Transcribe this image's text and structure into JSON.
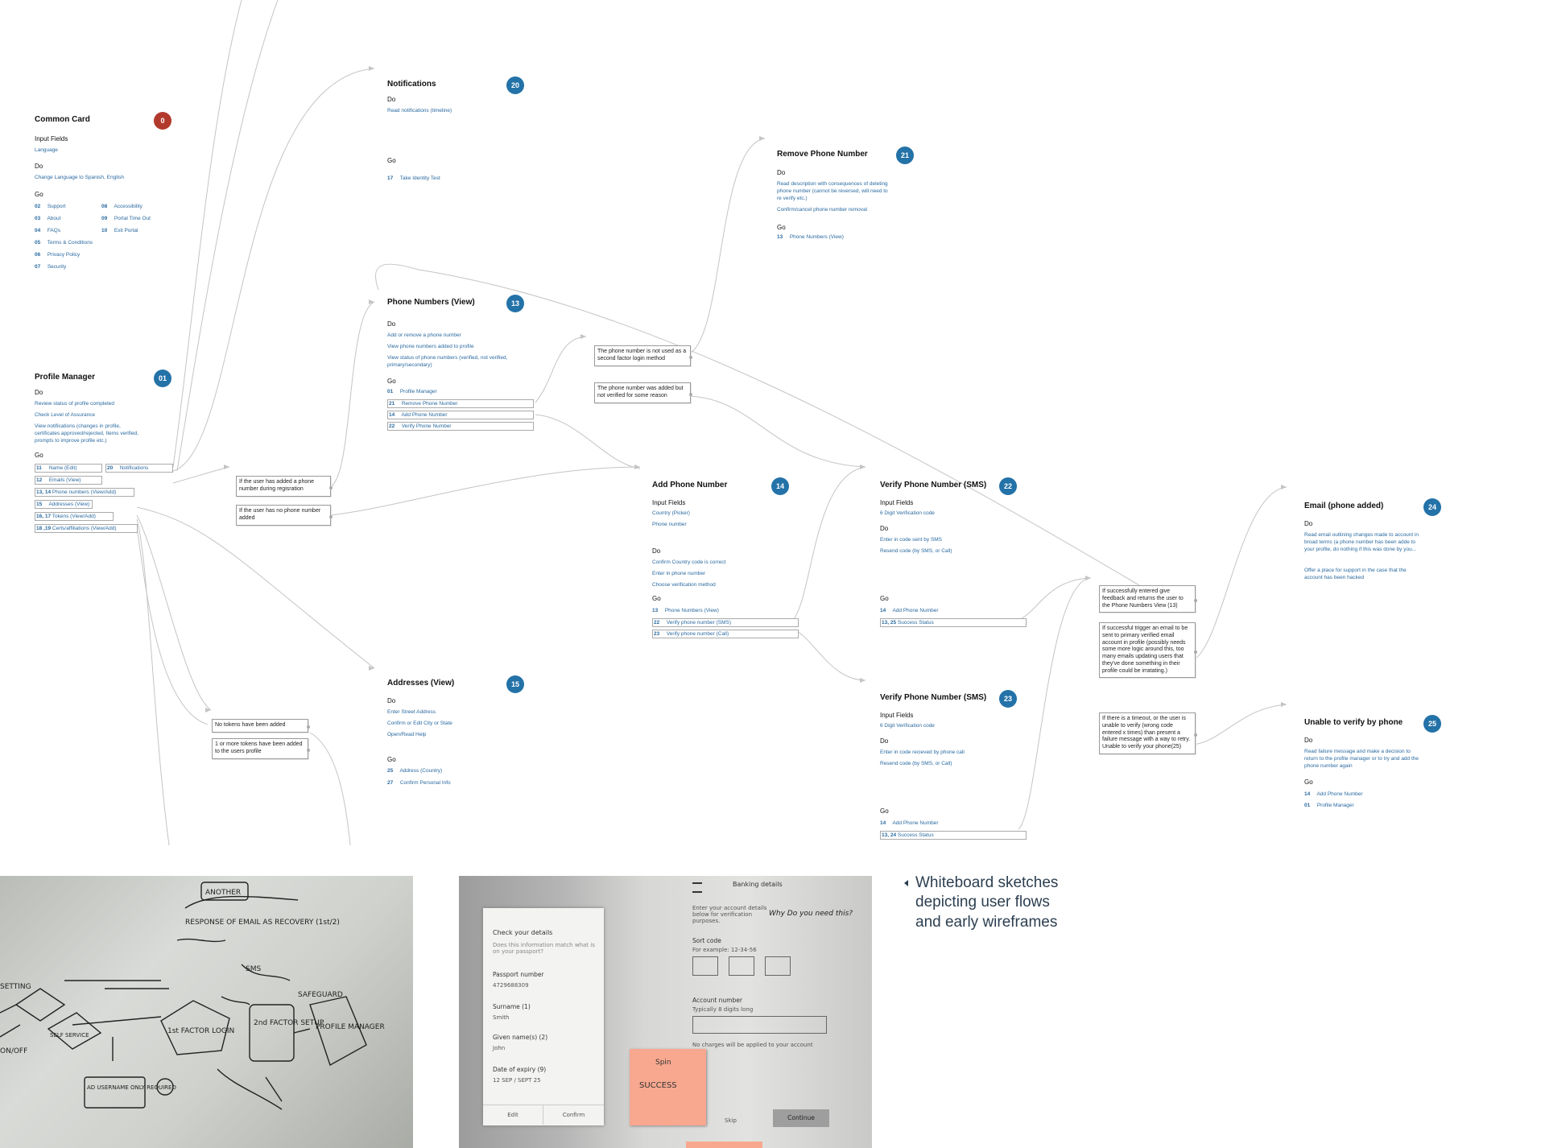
{
  "cards": {
    "common": {
      "title": "Common Card",
      "badge": "0",
      "l1": "Input Fields",
      "f1": "Language",
      "l2": "Do",
      "d1": "Change Language to Spanish, English",
      "l3": "Go",
      "g": [
        {
          "n": "02",
          "t": "Support"
        },
        {
          "n": "03",
          "t": "About"
        },
        {
          "n": "04",
          "t": "FAQs"
        },
        {
          "n": "05",
          "t": "Terms & Conditions"
        },
        {
          "n": "06",
          "t": "Privacy Policy"
        },
        {
          "n": "07",
          "t": "Security"
        },
        {
          "n": "08",
          "t": "Accessibility"
        },
        {
          "n": "09",
          "t": "Portal Time Out"
        },
        {
          "n": "10",
          "t": "Exit Portal"
        }
      ]
    },
    "notifications": {
      "title": "Notifications",
      "badge": "20",
      "l2": "Do",
      "d1": "Read notifications (timeline)",
      "l3": "Go",
      "g": [
        {
          "n": "17",
          "t": "Take Identity Test"
        }
      ]
    },
    "profile": {
      "title": "Profile Manager",
      "badge": "01",
      "l2": "Do",
      "d1": "Review status of profile completed",
      "d2": "Check Level of Assurance",
      "d3": "View notifications (changes in profile, certificates approved/rejected, Items verified, prompts to improve profile etc.)",
      "l3": "Go",
      "g": [
        {
          "n": "11",
          "t": "Name (Edit)"
        },
        {
          "n": "12",
          "t": "Emails (View)"
        },
        {
          "n": "13, 14",
          "t": "Phone numbers (View/Add)"
        },
        {
          "n": "15",
          "t": "Addresses (View)"
        },
        {
          "n": "16, 17",
          "t": "Tokens (View/Add)"
        },
        {
          "n": "18 ,19",
          "t": "Certs/affiliations (View/Add)"
        },
        {
          "n": "20",
          "t": "Notifications"
        }
      ]
    },
    "phone_view": {
      "title": "Phone Numbers (View)",
      "badge": "13",
      "l2": "Do",
      "d1": "Add or remove a phone number",
      "d2": "View phone numbers added to profile",
      "d3": "View status of phone numbers (verified, not verified, primary/secondary)",
      "l3": "Go",
      "g": [
        {
          "n": "01",
          "t": "Profile Manager"
        },
        {
          "n": "21",
          "t": "Remove Phone Number"
        },
        {
          "n": "14",
          "t": "Add Phone Number"
        },
        {
          "n": "22",
          "t": "Verify Phone Number"
        }
      ]
    },
    "remove_phone": {
      "title": "Remove Phone Number",
      "badge": "21",
      "l2": "Do",
      "d1": "Read description with consequences of deleting phone number (cannot be reversed, will need to re verify etc.)",
      "d2": "Confirm/cancel phone number removal",
      "l3": "Go",
      "g": [
        {
          "n": "13",
          "t": "Phone Numbers (View)"
        }
      ]
    },
    "add_phone": {
      "title": "Add Phone Number",
      "badge": "14",
      "l1": "Input Fields",
      "f1": "Country (Picker)",
      "f2": "Phone number",
      "l2": "Do",
      "d1": "Confirm Country code is correct",
      "d2": "Enter in phone number",
      "d3": "Choose verification method",
      "l3": "Go",
      "g": [
        {
          "n": "13",
          "t": "Phone Numbers (View)"
        },
        {
          "n": "22",
          "t": "Verify phone number (SMS)"
        },
        {
          "n": "23",
          "t": "Verify phone number (Call)"
        }
      ]
    },
    "verify_sms": {
      "title": "Verify Phone Number (SMS)",
      "badge": "22",
      "l1": "Input Fields",
      "f1": "6 Digit Verification code",
      "l2": "Do",
      "d1": "Enter in code sent by SMS",
      "d2": "Resend code (by SMS, or Call)",
      "l3": "Go",
      "g": [
        {
          "n": "14",
          "t": "Add Phone Number"
        },
        {
          "n": "13, 25",
          "t": "Success Status"
        }
      ]
    },
    "verify_call": {
      "title": "Verify Phone Number (SMS)",
      "badge": "23",
      "l1": "Input Fields",
      "f1": "6 Digit Verification code",
      "l2": "Do",
      "d1": "Enter in code recieved by phone call",
      "d2": "Resend code (by SMS, or Call)",
      "l3": "Go",
      "g": [
        {
          "n": "14",
          "t": "Add Phone Number"
        },
        {
          "n": "13, 24",
          "t": "Success Status"
        }
      ]
    },
    "addresses": {
      "title": "Addresses (View)",
      "badge": "15",
      "l2": "Do",
      "d1": "Enter Street Address",
      "d2": "Confirm or Edit City or State",
      "d3": "Open/Read Help",
      "l3": "Go",
      "g": [
        {
          "n": "25",
          "t": "Address (Country)"
        },
        {
          "n": "27",
          "t": "Confirm Personal Info"
        }
      ]
    },
    "email_added": {
      "title": "Email (phone added)",
      "badge": "24",
      "l2": "Do",
      "d1": "Read email outlining changes made to account in broad terms (a phone number has been adde to your profile, do nothing if this was done by you...",
      "d2": "Offer a place for support in the case that the account has been hacked"
    },
    "unable": {
      "title": "Unable to verify by phone",
      "badge": "25",
      "l2": "Do",
      "d1": "Read failure message and make a decision to return to the profile manager or to try and add the phone number again",
      "l3": "Go",
      "g": [
        {
          "n": "14",
          "t": "Add Phone Number"
        },
        {
          "n": "01",
          "t": "Profile Manager"
        }
      ]
    }
  },
  "notes": {
    "added_during_reg": "If the user has added a phone number during regisration",
    "no_phone": "If the user has no phone number added",
    "not_used": "The phone number is not used as a second factor login method",
    "not_verified": "The phone number was added but not verified for some reason",
    "no_tokens": "No tokens have been added",
    "tokens_added": "1 or more tokens have been added to the users profile",
    "success_feedback": "If successfully entered give feedback and returns the user to the Phone Numbers View (13)",
    "success_email": "If successful trigger an email to be sent to primary verified email account in profile (possibly needs some more logic around this, too many emails updating users that they've done something in their profile could be irratating.)",
    "timeout": "If there is a timeout, or the user is unable to verify (wrong code entered x times) than present a failure message with a way to retry. Unable to verify your phone(25)"
  },
  "caption": "Whiteboard sketches depicting user flows and early wireframes",
  "sketch2": {
    "title": "Banking details",
    "check": "Check your details",
    "q": "Does this information match what is on your passport?",
    "passport_label": "Passport number",
    "passport": "4729688309",
    "surname_label": "Surname (1)",
    "surname": "Smith",
    "given_label": "Given name(s) (2)",
    "given": "John",
    "expiry_label": "Date of expiry (9)",
    "expiry": "12 SEP / SEPT 25",
    "edit": "Edit",
    "confirm": "Confirm",
    "intro": "Enter your account details below for verification purposes.",
    "why": "Why Do you need this?",
    "sort_label": "Sort code",
    "sort_hint": "For example: 12-34-56",
    "acct_label": "Account number",
    "acct_hint": "Typically 8 digits long",
    "charges": "No charges will be applied to your account",
    "skip": "Skip",
    "continue": "Continue",
    "sticky1": "Spin",
    "sticky2": "SUCCESS"
  },
  "sketch1": {
    "t1": "ANOTHER",
    "t2": "SAFEGUARD",
    "t3": "2nd FACTOR SETUP",
    "t4": "1st FACTOR LOGIN",
    "t5": "PROFILE MANAGER",
    "t6": "AD USERNAME ONLY REQUIRED",
    "t7": "SELF SERVICE",
    "t8": "RESPONSE OF EMAIL AS RECOVERY (1st/2)",
    "t9": "SMS",
    "t10": "SETTING",
    "t11": "ON/OFF"
  }
}
